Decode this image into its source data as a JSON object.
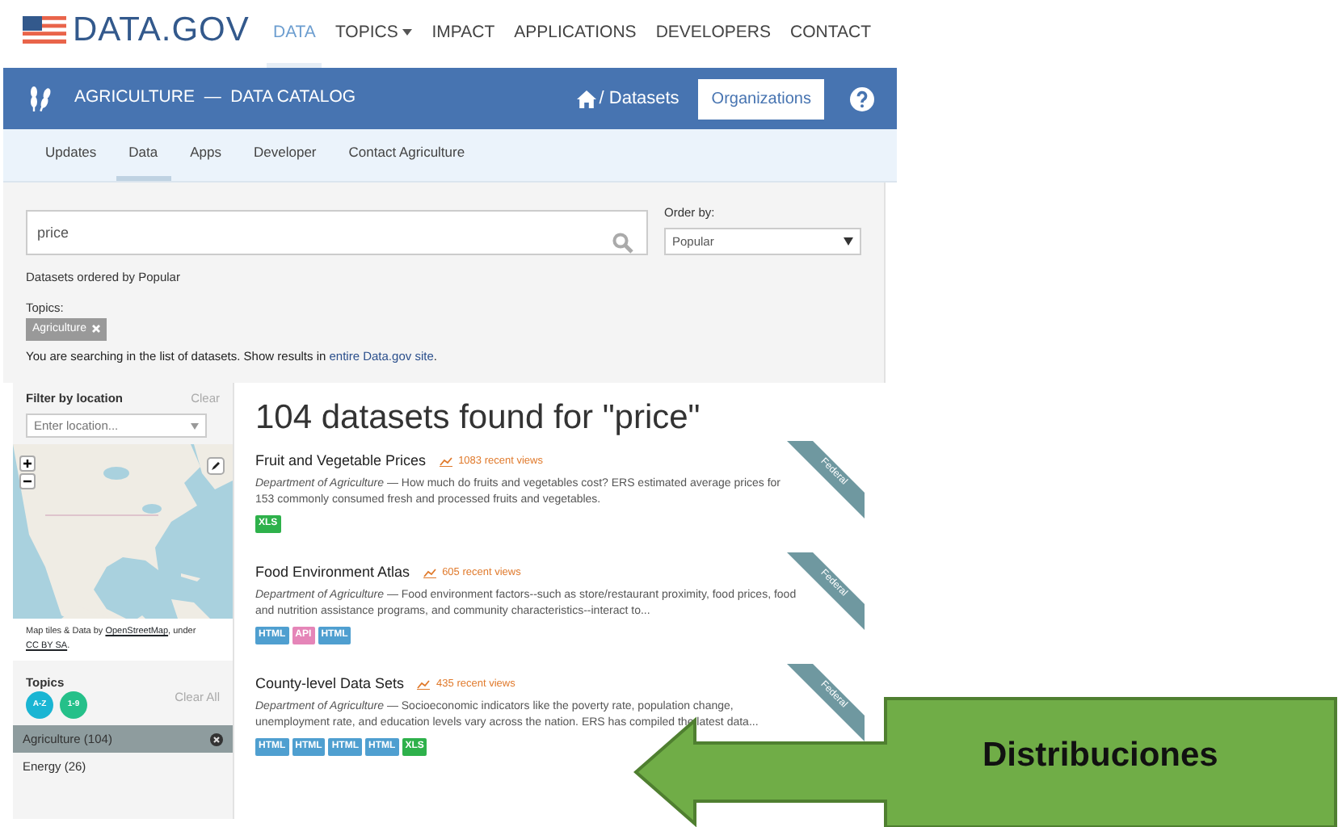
{
  "site": {
    "logo_text": "DATA.GOV",
    "nav": [
      {
        "label": "DATA",
        "selected": true,
        "has_menu": false
      },
      {
        "label": "TOPICS",
        "selected": false,
        "has_menu": true
      },
      {
        "label": "IMPACT",
        "selected": false,
        "has_menu": false
      },
      {
        "label": "APPLICATIONS",
        "selected": false,
        "has_menu": false
      },
      {
        "label": "DEVELOPERS",
        "selected": false,
        "has_menu": false
      },
      {
        "label": "CONTACT",
        "selected": false,
        "has_menu": false
      }
    ]
  },
  "catalog_bar": {
    "title": "AGRICULTURE",
    "separator": "—",
    "subtitle": "DATA CATALOG",
    "breadcrumb": "/ Datasets",
    "button": "Organizations"
  },
  "tabs": [
    {
      "label": "Updates",
      "selected": false
    },
    {
      "label": "Data",
      "selected": true
    },
    {
      "label": "Apps",
      "selected": false
    },
    {
      "label": "Developer",
      "selected": false
    },
    {
      "label": "Contact Agriculture",
      "selected": false
    }
  ],
  "search": {
    "value": "price",
    "order_label": "Order by:",
    "order_value": "Popular",
    "ordered_note": "Datasets ordered by Popular",
    "topics_label": "Topics:",
    "topic_tags": [
      "Agriculture"
    ],
    "scope_note": {
      "text": "You are searching in the list of datasets. Show results in ",
      "link": "entire Data.gov site",
      "after": "."
    }
  },
  "sidebar": {
    "filter_title": "Filter by location",
    "clear": "Clear",
    "location_placeholder": "Enter location...",
    "map_credit": {
      "text": "Map tiles & Data by ",
      "link1": "OpenStreetMap",
      "middle": ", under",
      "link2": "CC BY SA",
      "after": "."
    },
    "topics_title": "Topics",
    "sort_buttons": [
      {
        "label": "A-Z",
        "color": "#1ab5d3"
      },
      {
        "label": "1-9",
        "color": "#25c089"
      }
    ],
    "clear_all": "Clear All",
    "facets": [
      {
        "label": "Agriculture (104)",
        "selected": true
      },
      {
        "label": "Energy (26)",
        "selected": false
      }
    ]
  },
  "results": {
    "heading": "104 datasets found for \"price\"",
    "datasets": [
      {
        "title": "Fruit and Vegetable Prices",
        "views": "1083 recent views",
        "organization": "Department of Agriculture",
        "description": " — How much do fruits and vegetables cost? ERS estimated average prices for 153 commonly consumed fresh and processed fruits and vegetables.",
        "ribbon": "Federal",
        "formats": [
          {
            "label": "XLS",
            "color": "#2eb14b"
          }
        ]
      },
      {
        "title": "Food Environment Atlas",
        "views": "605 recent views",
        "organization": "Department of Agriculture",
        "description": " — Food environment factors--such as store/restaurant proximity, food prices, food and nutrition assistance programs, and community characteristics--interact to...",
        "ribbon": "Federal",
        "formats": [
          {
            "label": "HTML",
            "color": "#4f9fd0"
          },
          {
            "label": "API",
            "color": "#e585b8"
          },
          {
            "label": "HTML",
            "color": "#4f9fd0"
          }
        ]
      },
      {
        "title": "County-level Data Sets",
        "views": "435 recent views",
        "organization": "Department of Agriculture",
        "description": " — Socioeconomic indicators like the poverty rate, population change, unemployment rate, and education levels vary across the nation. ERS has compiled the latest data...",
        "ribbon": "Federal",
        "formats": [
          {
            "label": "HTML",
            "color": "#4f9fd0"
          },
          {
            "label": "HTML",
            "color": "#4f9fd0"
          },
          {
            "label": "HTML",
            "color": "#4f9fd0"
          },
          {
            "label": "HTML",
            "color": "#4f9fd0"
          },
          {
            "label": "XLS",
            "color": "#2eb14b"
          }
        ]
      }
    ]
  },
  "callout": {
    "text": "Distribuciones"
  }
}
